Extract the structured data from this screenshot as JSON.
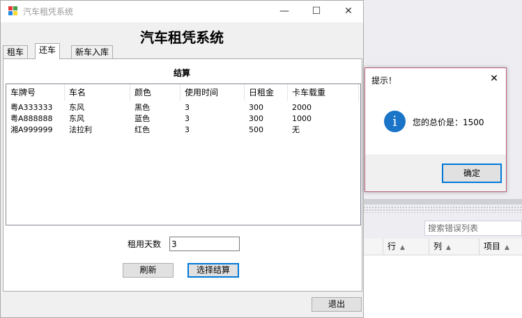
{
  "background": {
    "search_placeholder": "搜索错误列表",
    "columns": [
      {
        "label": "行"
      },
      {
        "label": "列"
      },
      {
        "label": "项目"
      }
    ]
  },
  "window": {
    "title": "汽车租凭系统",
    "minimize_glyph": "—",
    "maximize_glyph": "☐",
    "close_glyph": "✕"
  },
  "form": {
    "heading": "汽车租凭系统",
    "tabs": [
      {
        "label": "租车"
      },
      {
        "label": "还车"
      },
      {
        "label": "新车入库"
      }
    ],
    "group_title": "结算",
    "table": {
      "headers": [
        "车牌号",
        "车名",
        "颜色",
        "使用时间",
        "日租金",
        "卡车载重"
      ],
      "rows": [
        [
          "粤A333333",
          "东风",
          "黑色",
          "3",
          "300",
          "2000"
        ],
        [
          "粤A888888",
          "东风",
          "蓝色",
          "3",
          "300",
          "1000"
        ],
        [
          "湘A999999",
          "法拉利",
          "红色",
          "3",
          "500",
          "无"
        ]
      ]
    },
    "days_label": "租用天数",
    "days_value": "3",
    "refresh_label": "刷新",
    "settle_label": "选择结算",
    "exit_label": "退出"
  },
  "dialog": {
    "title": "提示！",
    "close_glyph": "✕",
    "icon": "info-icon",
    "icon_glyph": "i",
    "message": "您的总价是：1500",
    "ok_label": "确定"
  },
  "colors": {
    "accent": "#0078d7",
    "info_icon": "#1a74c7",
    "dialog_border": "#b55a76"
  }
}
